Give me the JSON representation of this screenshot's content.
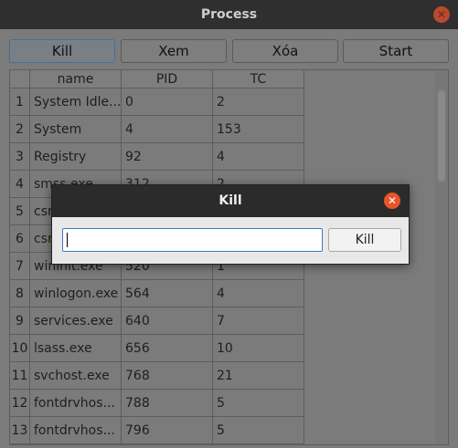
{
  "window": {
    "title": "Process",
    "close_glyph": "✕"
  },
  "toolbar": {
    "buttons": [
      "Kill",
      "Xem",
      "Xóa",
      "Start"
    ]
  },
  "table": {
    "columns": [
      "name",
      "PID",
      "TC"
    ],
    "rows": [
      {
        "idx": "1",
        "name": "System Idle...",
        "pid": "0",
        "tc": "2"
      },
      {
        "idx": "2",
        "name": "System",
        "pid": "4",
        "tc": "153"
      },
      {
        "idx": "3",
        "name": "Registry",
        "pid": "92",
        "tc": "4"
      },
      {
        "idx": "4",
        "name": "smss.exe",
        "pid": "312",
        "tc": "2"
      },
      {
        "idx": "5",
        "name": "csrss.exe",
        "pid": "",
        "tc": ""
      },
      {
        "idx": "6",
        "name": "csrss.exe",
        "pid": "",
        "tc": ""
      },
      {
        "idx": "7",
        "name": "wininit.exe",
        "pid": "520",
        "tc": "1"
      },
      {
        "idx": "8",
        "name": "winlogon.exe",
        "pid": "564",
        "tc": "4"
      },
      {
        "idx": "9",
        "name": "services.exe",
        "pid": "640",
        "tc": "7"
      },
      {
        "idx": "10",
        "name": "lsass.exe",
        "pid": "656",
        "tc": "10"
      },
      {
        "idx": "11",
        "name": "svchost.exe",
        "pid": "768",
        "tc": "21"
      },
      {
        "idx": "12",
        "name": "fontdrvhos...",
        "pid": "788",
        "tc": "5"
      },
      {
        "idx": "13",
        "name": "fontdrvhos...",
        "pid": "796",
        "tc": "5"
      }
    ]
  },
  "dialog": {
    "title": "Kill",
    "input_value": "",
    "button_label": "Kill",
    "close_glyph": "✕"
  }
}
